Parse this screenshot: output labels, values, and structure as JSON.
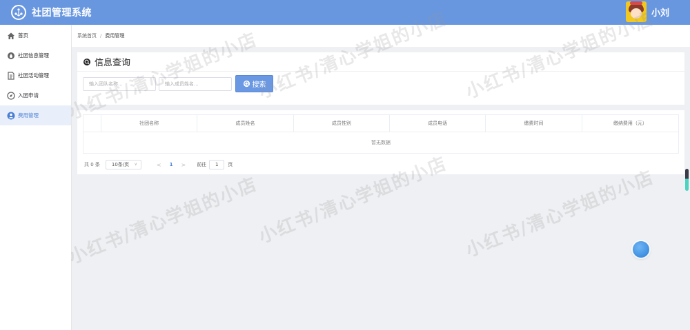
{
  "header": {
    "app_title": "社团管理系统",
    "user_name": "小刘",
    "colors": {
      "bar": "#6897e0"
    }
  },
  "sidebar": {
    "items": [
      {
        "label": "首页",
        "icon": "home-icon",
        "active": false
      },
      {
        "label": "社团信息管理",
        "icon": "droplet-icon",
        "active": false
      },
      {
        "label": "社团活动管理",
        "icon": "document-icon",
        "active": false
      },
      {
        "label": "入团申请",
        "icon": "compass-icon",
        "active": false
      },
      {
        "label": "费用管理",
        "icon": "user-badge-icon",
        "active": true
      }
    ]
  },
  "breadcrumb": {
    "home": "系统首页",
    "separator": "/",
    "current": "费用管理"
  },
  "search": {
    "title": "信息查询",
    "team_name_placeholder": "输入团队名称...",
    "member_name_placeholder": "输入成员姓名...",
    "button_label": "搜索"
  },
  "table": {
    "columns": [
      "社团名称",
      "成员姓名",
      "成员性别",
      "成员电话",
      "缴费时间",
      "缴纳费用（元）"
    ],
    "empty_text": "暂无数据"
  },
  "pagination": {
    "total": "共 0 条",
    "page_size": "10条/页",
    "prev": "<",
    "current_page": "1",
    "next": ">",
    "goto_label": "前往",
    "goto_value": "1",
    "goto_suffix": "页"
  },
  "watermark": "小红书/清心学姐的小店"
}
